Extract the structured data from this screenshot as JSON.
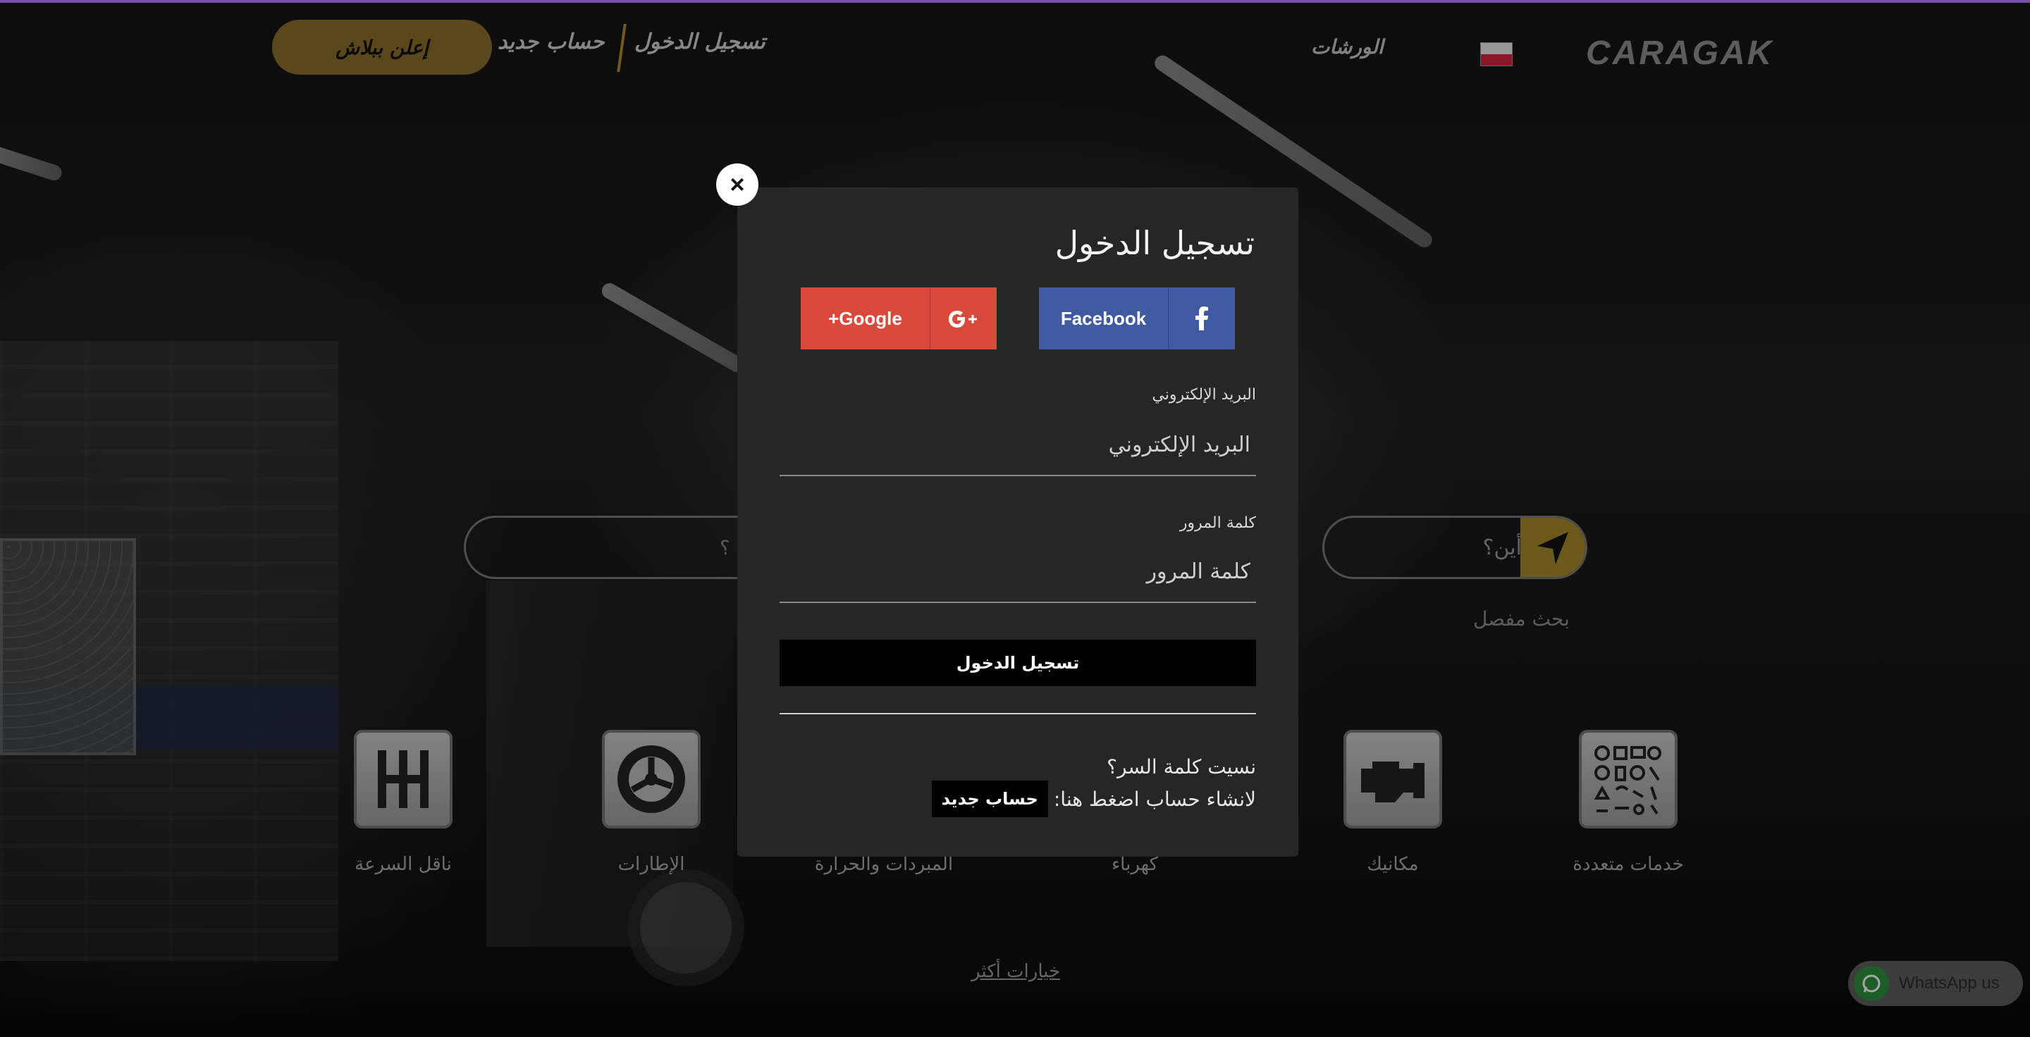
{
  "header": {
    "logo": "CARAGAK",
    "language_flag": "poland-flag",
    "nav_workshops": "الورشات",
    "nav_login": "تسجيل الدخول",
    "nav_register": "حساب جديد",
    "ad_button": "إعلن ببلاش"
  },
  "search": {
    "left_placeholder": "؟",
    "where_placeholder": "أين؟",
    "go_icon": "navigation-arrow-icon",
    "advanced_link": "بحث مفصل"
  },
  "categories": [
    {
      "label": "خدمات متعددة",
      "icon": "dashboard-symbols-icon"
    },
    {
      "label": "مكانيك",
      "icon": "engine-icon"
    },
    {
      "label": "كهرباء",
      "icon": "electricity-icon"
    },
    {
      "label": "المبردات والحرارة",
      "icon": "cooling-icon"
    },
    {
      "label": "الإطارات",
      "icon": "tire-icon"
    },
    {
      "label": "ناقل السرعة",
      "icon": "gearbox-icon"
    }
  ],
  "more_options": "خيارات أكثر",
  "whatsapp": {
    "label": "WhatsApp us",
    "icon": "whatsapp-icon",
    "color": "#2f8f3f"
  },
  "modal": {
    "title": "تسجيل الدخول",
    "close_symbol": "×",
    "facebook_label": "Facebook",
    "google_label": "+Google",
    "facebook_icon": "facebook-icon",
    "google_icon": "google-plus-icon",
    "email_label": "البريد الإلكتروني",
    "email_placeholder": "البريد الإلكتروني",
    "password_label": "كلمة المرور",
    "password_placeholder": "كلمة المرور",
    "submit_label": "تسجيل الدخول",
    "forgot_password": "نسيت كلمة السر؟",
    "create_prompt": "لانشاء حساب اضغط هنا:",
    "create_button": "حساب جديد"
  },
  "colors": {
    "accent_gold": "#a68a2c",
    "facebook": "#3f5aa0",
    "google": "#d94a3d",
    "modal_bg": "#262626"
  }
}
